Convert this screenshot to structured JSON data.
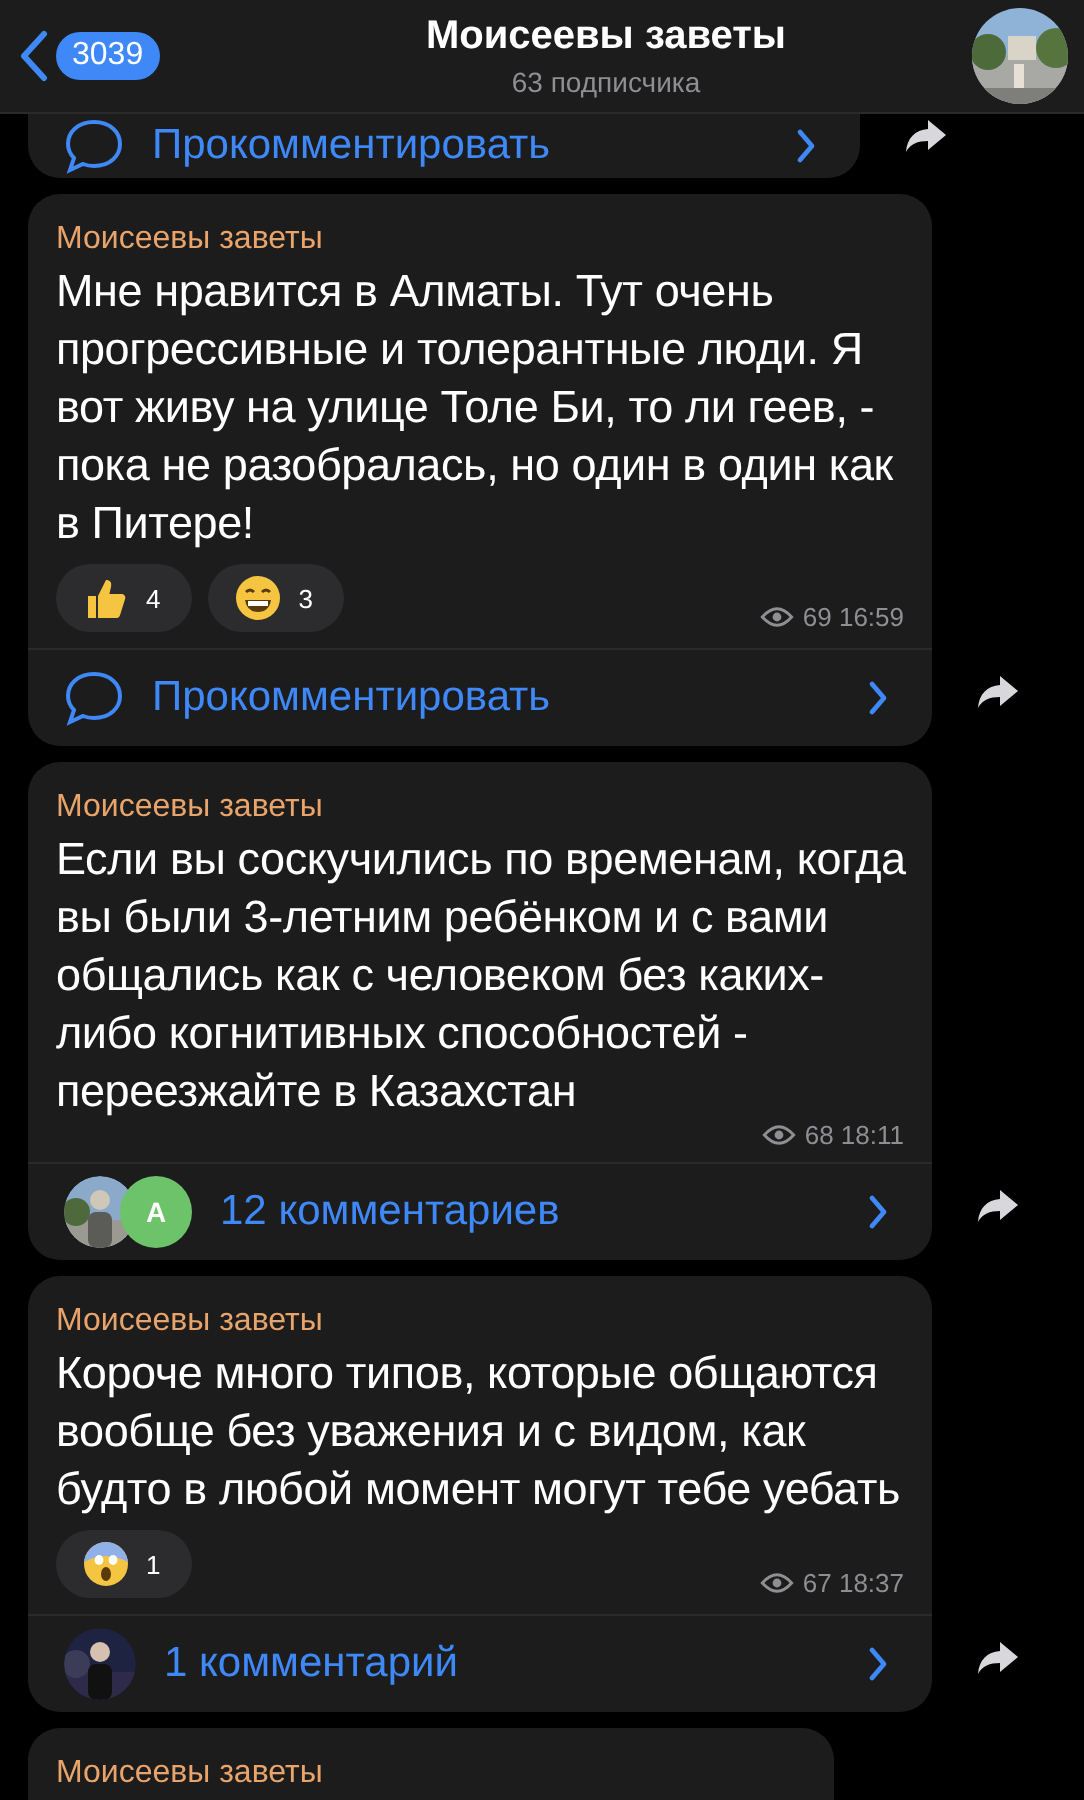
{
  "header": {
    "back_count": "3039",
    "title": "Моисеевы заветы",
    "subtitle": "63 подписчика",
    "avatar": {
      "kind": "picture"
    }
  },
  "posts": [
    {
      "kind": "tail",
      "comment": {
        "kind": "comment",
        "label": "Прокомментировать"
      }
    },
    {
      "kind": "message",
      "author": "Моисеевы заветы",
      "text": "Мне нравится в Алматы. Тут очень прогрессивные и толерантные люди. Я вот живу на улице Толе Би, то ли геев, - пока не разобралась, но один в один как в Питере!",
      "reactions": [
        {
          "kind": "thumbs_up",
          "count": "4"
        },
        {
          "kind": "grin",
          "count": "3"
        }
      ],
      "views": "69",
      "time": "16:59",
      "comment": {
        "kind": "comment",
        "label": "Прокомментировать"
      }
    },
    {
      "kind": "message",
      "author": "Моисеевы заветы",
      "text": "Если вы соскучились по временам, когда вы были 3-летним ребёнком и с вами общались как с человеком без каких-либо когнитивных способностей - переезжайте в Казахстан",
      "views": "68",
      "time": "18:11",
      "comment": {
        "kind": "avatars",
        "label": "12 комментариев",
        "avatars": [
          {
            "kind": "picture"
          },
          {
            "kind": "letter",
            "letter": "A",
            "color": "#6cc36a"
          }
        ]
      }
    },
    {
      "kind": "message",
      "author": "Моисеевы заветы",
      "text": "Короче много типов, которые общаются вообще без уважения и с видом, как будто в любой момент могут тебе уебать",
      "reactions": [
        {
          "kind": "scream",
          "count": "1"
        }
      ],
      "views": "67",
      "time": "18:37",
      "comment": {
        "kind": "avatars",
        "label": "1 комментарий",
        "avatars": [
          {
            "kind": "picture"
          }
        ]
      }
    },
    {
      "kind": "cut",
      "author": "Моисеевы заветы"
    }
  ]
}
